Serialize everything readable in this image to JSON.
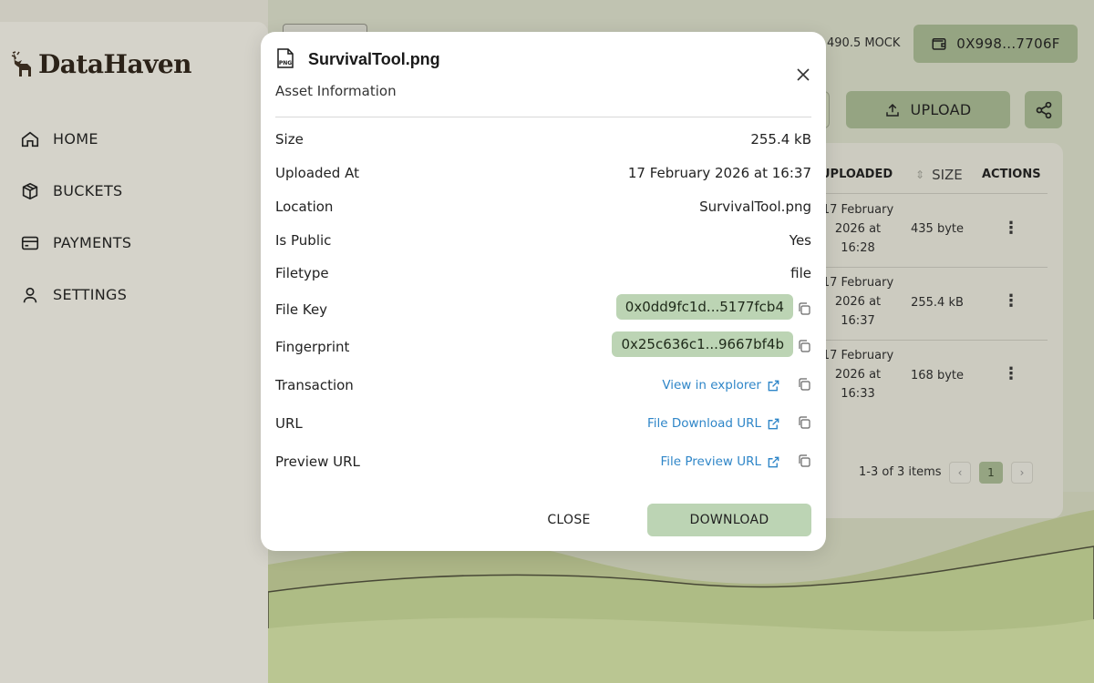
{
  "app": {
    "brand": "DataHaven",
    "nav": [
      {
        "label": "HOME",
        "icon": "home-icon"
      },
      {
        "label": "BUCKETS",
        "icon": "box-icon"
      },
      {
        "label": "PAYMENTS",
        "icon": "card-icon"
      },
      {
        "label": "SETTINGS",
        "icon": "user-icon"
      }
    ],
    "header": {
      "balance": "490.5 MOCK",
      "wallet": "0X998...7706F",
      "upload_label": "UPLOAD"
    },
    "table": {
      "headers": {
        "uploaded": "UPLOADED",
        "size": "SIZE",
        "actions": "ACTIONS"
      },
      "rows": [
        {
          "uploaded_l1": "17 February",
          "uploaded_l2": "2026 at",
          "uploaded_l3": "16:28",
          "size": "435 byte"
        },
        {
          "uploaded_l1": "17 February",
          "uploaded_l2": "2026 at",
          "uploaded_l3": "16:37",
          "size": "255.4 kB"
        },
        {
          "uploaded_l1": "17 February",
          "uploaded_l2": "2026 at",
          "uploaded_l3": "16:33",
          "size": "168 byte"
        }
      ],
      "pagination": {
        "summary": "1-3 of 3 items",
        "current_page": "1",
        "prev": "‹",
        "next": "›"
      }
    }
  },
  "modal": {
    "file_badge": "PNG",
    "title": "SurvivalTool.png",
    "subtitle": "Asset Information",
    "fields": {
      "size": {
        "label": "Size",
        "value": "255.4 kB"
      },
      "uploaded_at": {
        "label": "Uploaded At",
        "value": "17 February 2026 at 16:37"
      },
      "location": {
        "label": "Location",
        "value": "SurvivalTool.png"
      },
      "is_public": {
        "label": "Is Public",
        "value": "Yes"
      },
      "filetype": {
        "label": "Filetype",
        "value": "file"
      },
      "file_key": {
        "label": "File Key",
        "value": "0x0dd9fc1d...5177fcb4"
      },
      "fingerprint": {
        "label": "Fingerprint",
        "value": "0x25c636c1...9667bf4b"
      },
      "transaction": {
        "label": "Transaction",
        "link": "View in explorer"
      },
      "url": {
        "label": "URL",
        "link": "File Download URL"
      },
      "preview_url": {
        "label": "Preview URL",
        "link": "File Preview URL"
      }
    },
    "buttons": {
      "close": "CLOSE",
      "download": "DOWNLOAD"
    }
  },
  "colors": {
    "accent_green": "#9eae8a",
    "chip_green": "#bcd4b4",
    "link_blue": "#2f86c8",
    "modal_bg": "#ffffff"
  }
}
